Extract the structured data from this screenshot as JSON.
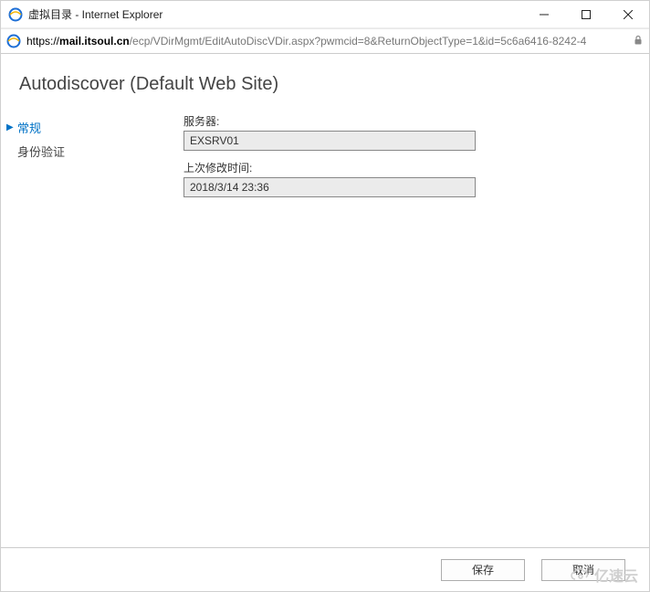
{
  "window": {
    "title": "虚拟目录 - Internet Explorer"
  },
  "addressbar": {
    "protocol": "https://",
    "domain": "mail.itsoul.cn",
    "path": "/ecp/VDirMgmt/EditAutoDiscVDir.aspx?pwmcid=8&ReturnObjectType=1&id=5c6a6416-8242-4"
  },
  "page": {
    "title": "Autodiscover (Default Web Site)"
  },
  "sidebar": {
    "items": [
      {
        "label": "常规",
        "active": true
      },
      {
        "label": "身份验证",
        "active": false
      }
    ]
  },
  "fields": {
    "server": {
      "label": "服务器:",
      "value": "EXSRV01"
    },
    "modified": {
      "label": "上次修改时间:",
      "value": "2018/3/14 23:36"
    }
  },
  "buttons": {
    "save": "保存",
    "cancel": "取消"
  },
  "watermark": "亿速云"
}
